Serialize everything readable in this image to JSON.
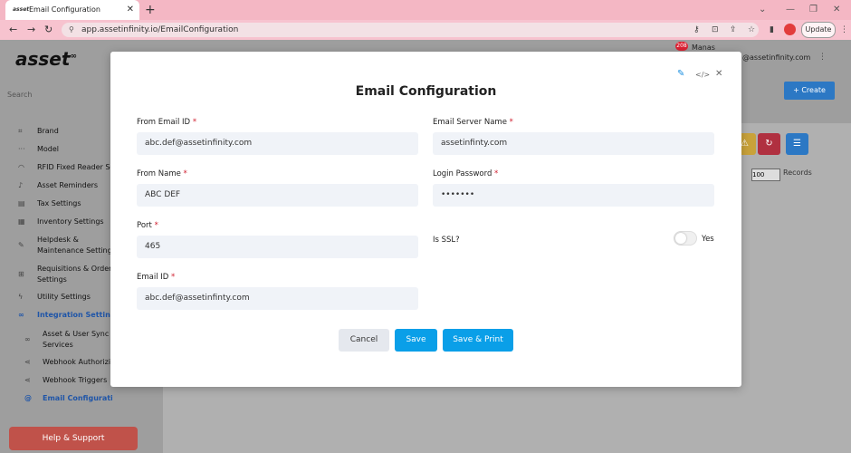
{
  "browser": {
    "tab_title": "Email Configuration",
    "new_tab": "+",
    "url": "app.assetinfinity.io/EmailConfiguration",
    "update_label": "Update"
  },
  "app": {
    "logo": "asset",
    "logo_sup": "∞",
    "search_label": "Search",
    "user_name": "Manas",
    "notification_count": "208",
    "user_email": "@assetinfinity.com",
    "create_label": "+ Create",
    "records_label": "Records",
    "records_value": "100",
    "help_label": "Help & Support",
    "sidebar": [
      {
        "label": "Brand",
        "icon": "tag-icon"
      },
      {
        "label": "Model",
        "icon": "dots-icon"
      },
      {
        "label": "RFID Fixed Reader Se",
        "icon": "wifi-icon"
      },
      {
        "label": "Asset Reminders",
        "icon": "bell-icon"
      },
      {
        "label": "Tax Settings",
        "icon": "tax-icon"
      },
      {
        "label": "Inventory Settings",
        "icon": "inventory-icon"
      },
      {
        "label": "Helpdesk &",
        "label2": "Maintenance Setting",
        "icon": "wrench-icon"
      },
      {
        "label": "Requisitions & Order",
        "label2": "Settings",
        "icon": "cart-icon"
      },
      {
        "label": "Utility Settings",
        "icon": "bolt-icon"
      },
      {
        "label": "Integration Settings",
        "icon": "link-icon"
      }
    ],
    "sidebar_sub": [
      {
        "label": "Asset & User Sync",
        "label2": "Services",
        "icon": "link-icon"
      },
      {
        "label": "Webhook Authorizi",
        "icon": "share-icon"
      },
      {
        "label": "Webhook Triggers",
        "icon": "share-icon"
      },
      {
        "label": "Email Configuration",
        "icon": "at-icon"
      }
    ]
  },
  "modal": {
    "title": "Email Configuration",
    "fields": {
      "from_email": {
        "label": "From Email ID",
        "value": "abc.def@assetinfinity.com"
      },
      "server_name": {
        "label": "Email Server Name",
        "value": "assetinfinty.com"
      },
      "from_name": {
        "label": "From Name",
        "value": "ABC DEF"
      },
      "login_password": {
        "label": "Login Password",
        "value": "•••••••"
      },
      "port": {
        "label": "Port",
        "value": "465"
      },
      "is_ssl": {
        "label": "Is SSL?",
        "toggle_text": "Yes"
      },
      "email_id": {
        "label": "Email ID",
        "value": "abc.def@assetinfinty.com"
      }
    },
    "buttons": {
      "cancel": "Cancel",
      "save": "Save",
      "save_print": "Save & Print"
    }
  },
  "colors": {
    "primary": "#0a9fe8",
    "required": "#d02030",
    "create": "#2c78c4",
    "help": "#c0524a"
  }
}
